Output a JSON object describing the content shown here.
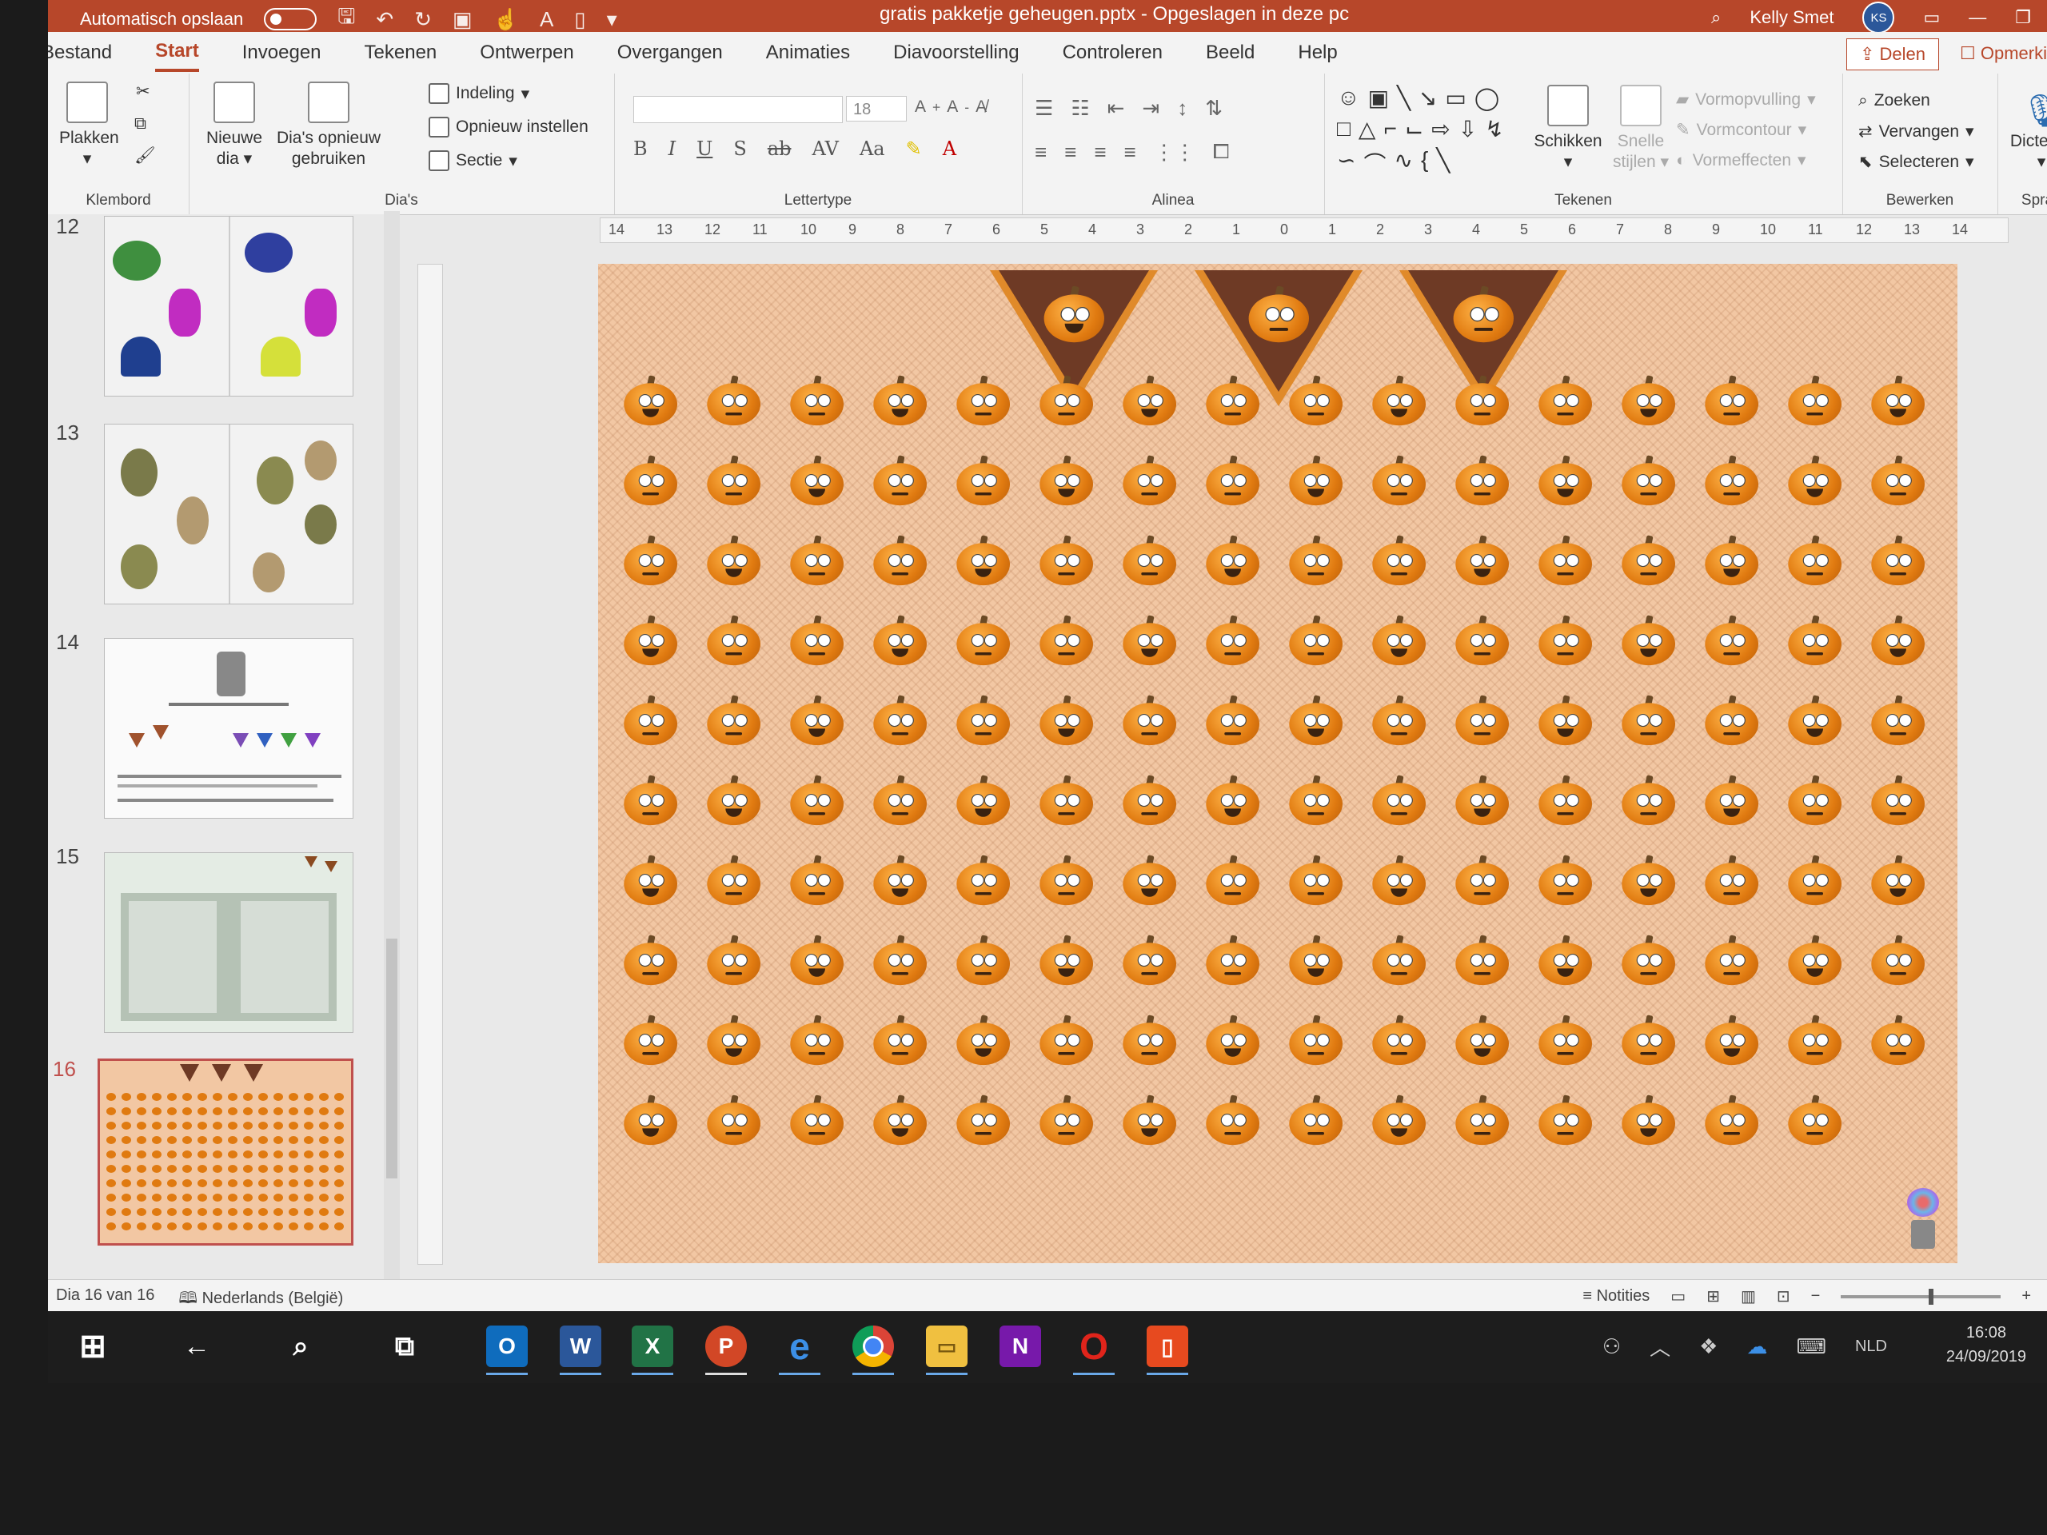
{
  "titlebar": {
    "autosave": "Automatisch opslaan",
    "document": "gratis pakketje geheugen.pptx - Opgeslagen in deze pc",
    "user": "Kelly Smet",
    "initials": "KS"
  },
  "tabs": [
    "Bestand",
    "Start",
    "Invoegen",
    "Tekenen",
    "Ontwerpen",
    "Overgangen",
    "Animaties",
    "Diavoorstelling",
    "Controleren",
    "Beeld",
    "Help"
  ],
  "active_tab": "Start",
  "share_label": "Delen",
  "comments_label": "Opmerki",
  "ribbon": {
    "klembord": {
      "label": "Klembord",
      "paste": "Plakken"
    },
    "dias": {
      "label": "Dia's",
      "new_slide_1": "Nieuwe",
      "new_slide_2": "dia",
      "reuse_1": "Dia's opnieuw",
      "reuse_2": "gebruiken",
      "layout": "Indeling",
      "reset": "Opnieuw instellen",
      "section": "Sectie"
    },
    "lettertype": {
      "label": "Lettertype",
      "size": "18"
    },
    "alinea": {
      "label": "Alinea"
    },
    "tekenen": {
      "label": "Tekenen",
      "arrange": "Schikken",
      "quick_styles_1": "Snelle",
      "quick_styles_2": "stijlen",
      "fill": "Vormopvulling",
      "outline": "Vormcontour",
      "effects": "Vormeffecten"
    },
    "bewerken": {
      "label": "Bewerken",
      "find": "Zoeken",
      "replace": "Vervangen",
      "select": "Selecteren"
    },
    "spraak": {
      "label": "Spraak",
      "dictate": "Dicteren"
    }
  },
  "thumbnails": [
    {
      "num": "12"
    },
    {
      "num": "13"
    },
    {
      "num": "14"
    },
    {
      "num": "15"
    },
    {
      "num": "16",
      "selected": true
    }
  ],
  "ruler_labels": [
    "14",
    "13",
    "12",
    "11",
    "10",
    "9",
    "8",
    "7",
    "6",
    "5",
    "4",
    "3",
    "2",
    "1",
    "0",
    "1",
    "2",
    "3",
    "4",
    "5",
    "6",
    "7",
    "8",
    "9",
    "10",
    "11",
    "12",
    "13",
    "14"
  ],
  "status": {
    "slide": "Dia 16 van 16",
    "language": "Nederlands (België)",
    "notes": "Notities"
  },
  "taskbar": {
    "lang": "NLD",
    "time": "16:08",
    "date": "24/09/2019"
  },
  "colors": {
    "accent": "#b7472a",
    "slide_bg": "#f2c7a3",
    "bunting": "#6e3a25"
  }
}
